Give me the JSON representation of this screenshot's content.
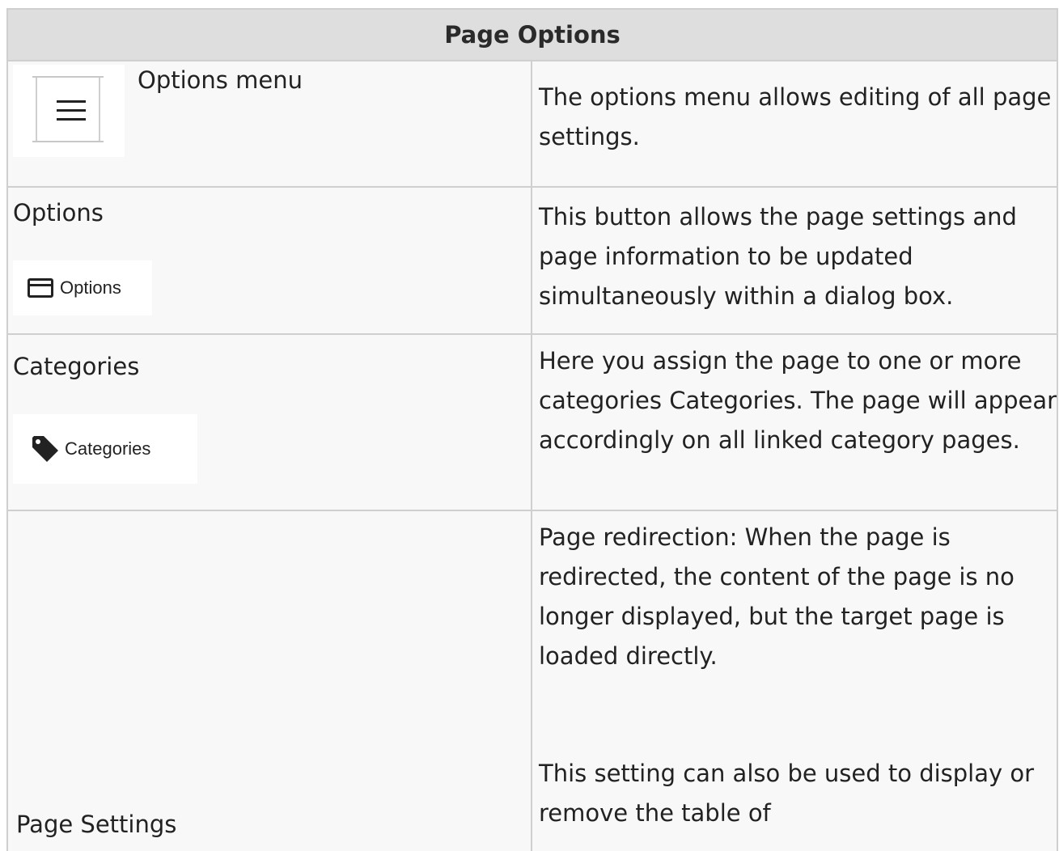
{
  "table": {
    "title": "Page Options",
    "rows": [
      {
        "label": "Options menu",
        "description": "The options menu allows editing of all page settings.",
        "image_icon": "hamburger-menu-icon"
      },
      {
        "label": "Options",
        "button_text": "Options",
        "image_icon": "window-icon",
        "description": "This button allows the page settings and page information to be updated simultaneously within a dialog box."
      },
      {
        "label": "Categories",
        "button_text": "Categories",
        "image_icon": "tag-icon",
        "description": "Here you assign the page to one or more categories Categories. The page will appear accordingly on all linked category pages."
      },
      {
        "label": "Page Settings",
        "description_1": "Page redirection: When the page is redirected, the content of the page is no longer displayed, but the target page is loaded directly.",
        "description_2": "This setting can also be used to display or remove the table of"
      }
    ]
  }
}
